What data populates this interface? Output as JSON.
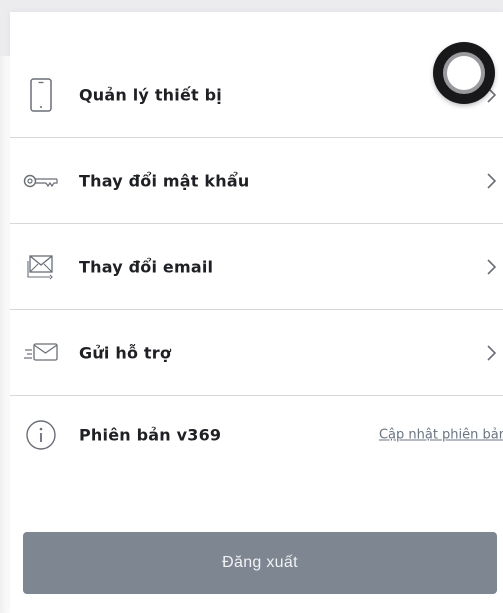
{
  "menu": {
    "items": [
      {
        "label": "Quản lý thiết bị",
        "icon": "phone-icon"
      },
      {
        "label": "Thay đổi mật khẩu",
        "icon": "key-icon"
      },
      {
        "label": "Thay đổi email",
        "icon": "email-icon"
      },
      {
        "label": "Gửi hỗ trợ",
        "icon": "send-support-icon"
      }
    ],
    "version": {
      "label": "Phiên bản v369",
      "icon": "info-icon",
      "update_link": "Cập nhật phiên bản"
    }
  },
  "logout": {
    "label": "Đăng xuất"
  },
  "overlay": {
    "icon": "circle-button-icon"
  }
}
